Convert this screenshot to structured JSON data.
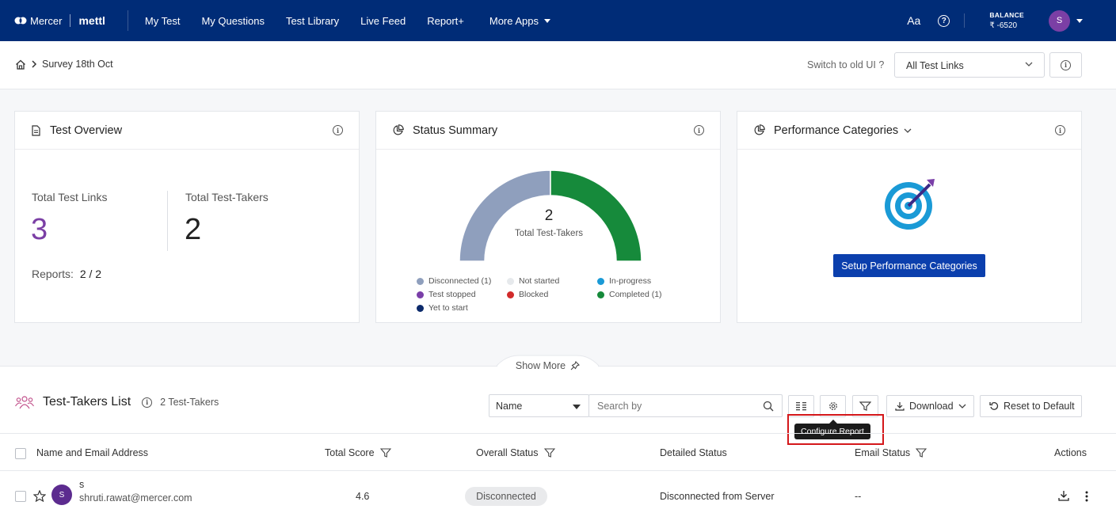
{
  "nav": {
    "brand": "Mercer",
    "product": "mettl",
    "items": [
      "My Test",
      "My Questions",
      "Test Library",
      "Live Feed",
      "Report+",
      "More Apps"
    ],
    "font_toggle": "Aa",
    "help": "?",
    "balance_label": "BALANCE",
    "balance_value": "₹ -6520",
    "user_initial": "S"
  },
  "breadcrumb": {
    "current": "Survey 18th Oct"
  },
  "subbar": {
    "switch_ui": "Switch to old UI ?",
    "test_link_filter": "All Test Links"
  },
  "overview": {
    "title": "Test Overview",
    "total_links_label": "Total Test Links",
    "total_links_value": "3",
    "total_takers_label": "Total Test-Takers",
    "total_takers_value": "2",
    "reports_label": "Reports:",
    "reports_value": "2 / 2"
  },
  "status": {
    "title": "Status Summary",
    "center_value": "2",
    "center_label": "Total Test-Takers",
    "legend": [
      {
        "label": "Disconnected (1)",
        "color": "#8f9fbd"
      },
      {
        "label": "Not started",
        "color": "#e6e9ec"
      },
      {
        "label": "In-progress",
        "color": "#1a9ad6"
      },
      {
        "label": "Test stopped",
        "color": "#7a3fa8"
      },
      {
        "label": "Blocked",
        "color": "#d12b2b"
      },
      {
        "label": "Completed (1)",
        "color": "#168a3b"
      },
      {
        "label": "Yet to start",
        "color": "#0c2a6b"
      }
    ]
  },
  "chart_data": {
    "type": "pie",
    "categories": [
      "Disconnected",
      "Not started",
      "In-progress",
      "Test stopped",
      "Blocked",
      "Completed",
      "Yet to start"
    ],
    "values": [
      1,
      0,
      0,
      0,
      0,
      1,
      0
    ],
    "title": "Status Summary"
  },
  "performance": {
    "title": "Performance Categories",
    "setup_button": "Setup Performance Categories"
  },
  "show_more": "Show More",
  "list": {
    "title": "Test-Takers List",
    "count": "2 Test-Takers",
    "search_field": "Name",
    "search_placeholder": "Search by",
    "download": "Download",
    "reset": "Reset to Default",
    "tooltip": "Configure Report",
    "columns": {
      "name": "Name and Email Address",
      "score": "Total Score",
      "overall": "Overall Status",
      "detailed": "Detailed Status",
      "email": "Email Status",
      "actions": "Actions"
    },
    "rows": [
      {
        "initial": "S",
        "name": "s",
        "email": "shruti.rawat@mercer.com",
        "score": "4.6",
        "overall": "Disconnected",
        "detailed": "Disconnected from Server",
        "email_status": "--"
      }
    ]
  }
}
